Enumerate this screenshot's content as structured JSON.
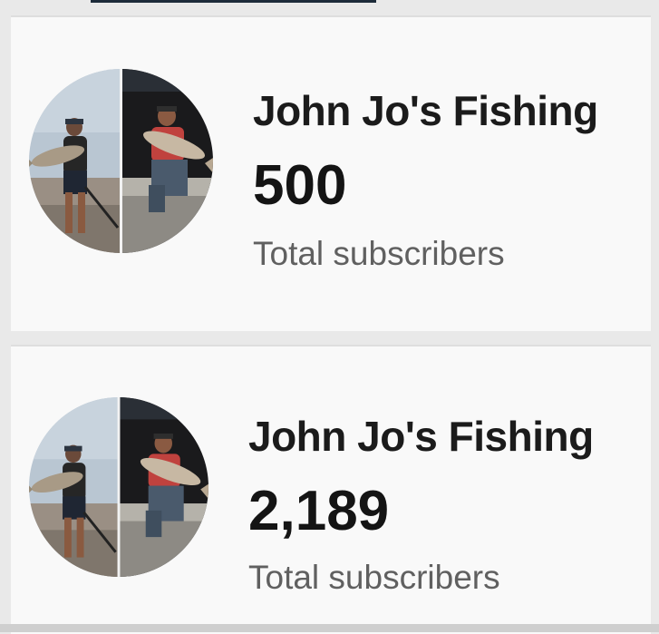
{
  "cards": [
    {
      "channel_name": "John Jo's Fishing",
      "subscriber_count": "500",
      "subscriber_label": "Total subscribers"
    },
    {
      "channel_name": "John Jo's Fishing",
      "subscriber_count": "2,189",
      "subscriber_label": "Total subscribers"
    }
  ],
  "colors": {
    "card_background": "#f9f9f9",
    "page_background": "#e9e9e9",
    "title_text": "#1b1b1b",
    "label_text": "#606060"
  }
}
